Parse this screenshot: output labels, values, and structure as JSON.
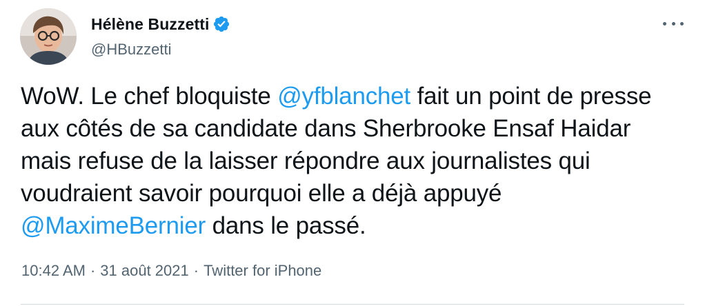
{
  "author": {
    "display_name": "Hélène Buzzetti",
    "handle": "@HBuzzetti",
    "verified": true
  },
  "tweet": {
    "text_1": "WoW. Le chef bloquiste ",
    "mention_1": "@yfblanchet",
    "text_2": " fait un point de presse aux côtés de sa candidate dans Sherbrooke Ensaf Haidar mais refuse de la laisser répondre aux journalistes qui voudraient savoir pourquoi elle a déjà appuyé ",
    "mention_2": "@MaximeBernier",
    "text_3": " dans le passé."
  },
  "meta": {
    "time": "10:42 AM",
    "separator": "·",
    "date": "31 août 2021",
    "source": "Twitter for iPhone"
  },
  "colors": {
    "text": "#0f1419",
    "secondary": "#536471",
    "accent": "#1d9bf0"
  },
  "icons": {
    "verified": "verified-badge-icon",
    "more": "more-options-icon"
  }
}
